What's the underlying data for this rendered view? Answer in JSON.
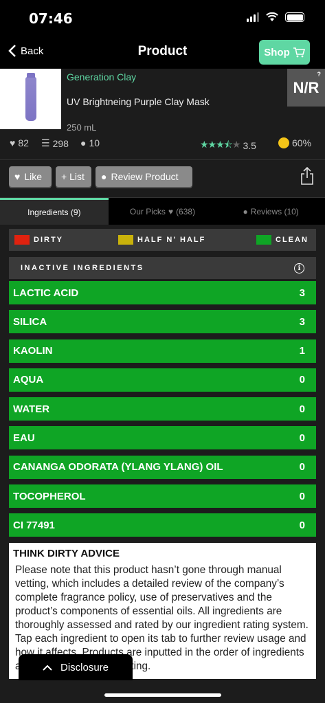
{
  "status": {
    "time": "07:46"
  },
  "nav": {
    "back": "Back",
    "title": "Product",
    "shop": "Shop"
  },
  "product": {
    "brand": "Generation Clay",
    "name": "UV Brightneing Purple Clay Mask",
    "volume": "250 mL",
    "badge": "N/R",
    "badge_help": "?"
  },
  "stats": {
    "likes": "82",
    "lists": "298",
    "comments": "10",
    "rating": "3.5",
    "rating_stars": 3.5,
    "approval": "60%"
  },
  "actions": {
    "like": "Like",
    "list": "+ List",
    "review": "Review Product"
  },
  "tabs": [
    {
      "label": "Ingredients (9)"
    },
    {
      "label": "Our Picks",
      "count": "(638)"
    },
    {
      "label": "Reviews (10)"
    }
  ],
  "legend": [
    {
      "label": "DIRTY",
      "color": "#e0220f"
    },
    {
      "label": "HALF N' HALF",
      "color": "#c9b20b"
    },
    {
      "label": "CLEAN",
      "color": "#0fa525"
    }
  ],
  "section": {
    "title": "INACTIVE INGREDIENTS"
  },
  "ingredients": [
    {
      "name": "LACTIC ACID",
      "score": "3"
    },
    {
      "name": "SILICA",
      "score": "3"
    },
    {
      "name": "KAOLIN",
      "score": "1"
    },
    {
      "name": "AQUA",
      "score": "0"
    },
    {
      "name": "WATER",
      "score": "0"
    },
    {
      "name": "EAU",
      "score": "0"
    },
    {
      "name": "CANANGA ODORATA (YLANG YLANG) OIL",
      "score": "0"
    },
    {
      "name": "TOCOPHEROL",
      "score": "0"
    },
    {
      "name": "CI 77491",
      "score": "0"
    }
  ],
  "advice": {
    "title": "THINK DIRTY ADVICE",
    "body": "Please note that this product hasn’t gone through manual vetting, which includes a detailed review of the company’s complete fragrance policy, use of preservatives and the product’s components of essential oils. All ingredients are thoroughly assessed and rated by our ingredient rating system. Tap each ingredient to open its tab to further review usage and how it affects. Products are inputted in the order of ingredients and/or through priority listing."
  },
  "disclosure": {
    "label": "Disclosure"
  },
  "colors": {
    "accent": "#5fd7a3",
    "clean": "#0fa525"
  }
}
